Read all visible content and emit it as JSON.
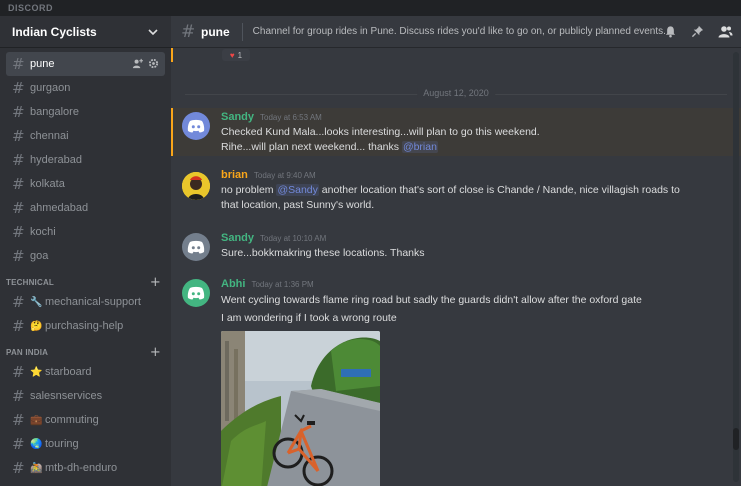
{
  "app": {
    "brand": "DISCORD"
  },
  "server": {
    "name": "Indian Cyclists"
  },
  "channels_top": [
    {
      "name": "pune",
      "active": true
    },
    {
      "name": "gurgaon"
    },
    {
      "name": "bangalore"
    },
    {
      "name": "chennai"
    },
    {
      "name": "hyderabad"
    },
    {
      "name": "kolkata"
    },
    {
      "name": "ahmedabad"
    },
    {
      "name": "kochi"
    },
    {
      "name": "goa"
    }
  ],
  "categories": [
    {
      "name": "TECHNICAL",
      "channels": [
        {
          "name": "mechanical-support",
          "emoji": "🔧"
        },
        {
          "name": "purchasing-help",
          "emoji": "🤔"
        }
      ]
    },
    {
      "name": "PAN INDIA",
      "channels": [
        {
          "name": "starboard",
          "emoji": "⭐"
        },
        {
          "name": "salesnservices",
          "emoji": ""
        },
        {
          "name": "commuting",
          "emoji": "💼"
        },
        {
          "name": "touring",
          "emoji": "🌏"
        },
        {
          "name": "mtb-dh-enduro",
          "emoji": "🚵"
        }
      ]
    }
  ],
  "channel": {
    "name": "pune",
    "topic": "Channel for group rides in Pune. Discuss rides you'd like to go on, or publicly planned events."
  },
  "reaction": {
    "count": "1"
  },
  "date_divider": "August 12, 2020",
  "messages": [
    {
      "author": "Sandy",
      "time": "Today at 6:53 AM",
      "color": "#43b581",
      "lines": [
        "Checked Kund Mala...looks interesting...will plan to go this weekend."
      ],
      "line2_prefix": "Rihe...will plan next weekend... thanks ",
      "line2_mention": "@brian"
    },
    {
      "author": "brian",
      "time": "Today at 9:40 AM",
      "color": "#faa61a",
      "line1_prefix": "no problem ",
      "line1_mention": "@Sandy",
      "line1_suffix": " another location that's sort of close is Chande / Nande, nice villagish roads to",
      "line2": "that location, past Sunny's world."
    },
    {
      "author": "Sandy",
      "time": "Today at 10:10 AM",
      "color": "#43b581",
      "line1": "Sure...bokkmakring these locations. Thanks"
    },
    {
      "author": "Abhi",
      "time": "Today at 1:36 PM",
      "color": "#43b581",
      "line1": "Went cycling towards flame ring road but sadly the guards didn't allow after the oxford gate",
      "line2": "I am wondering if I took a wrong route"
    }
  ],
  "colors": {
    "accent": "#7289da",
    "mention_highlight": "#faa61a",
    "green": "#43b581",
    "orange": "#faa61a"
  }
}
